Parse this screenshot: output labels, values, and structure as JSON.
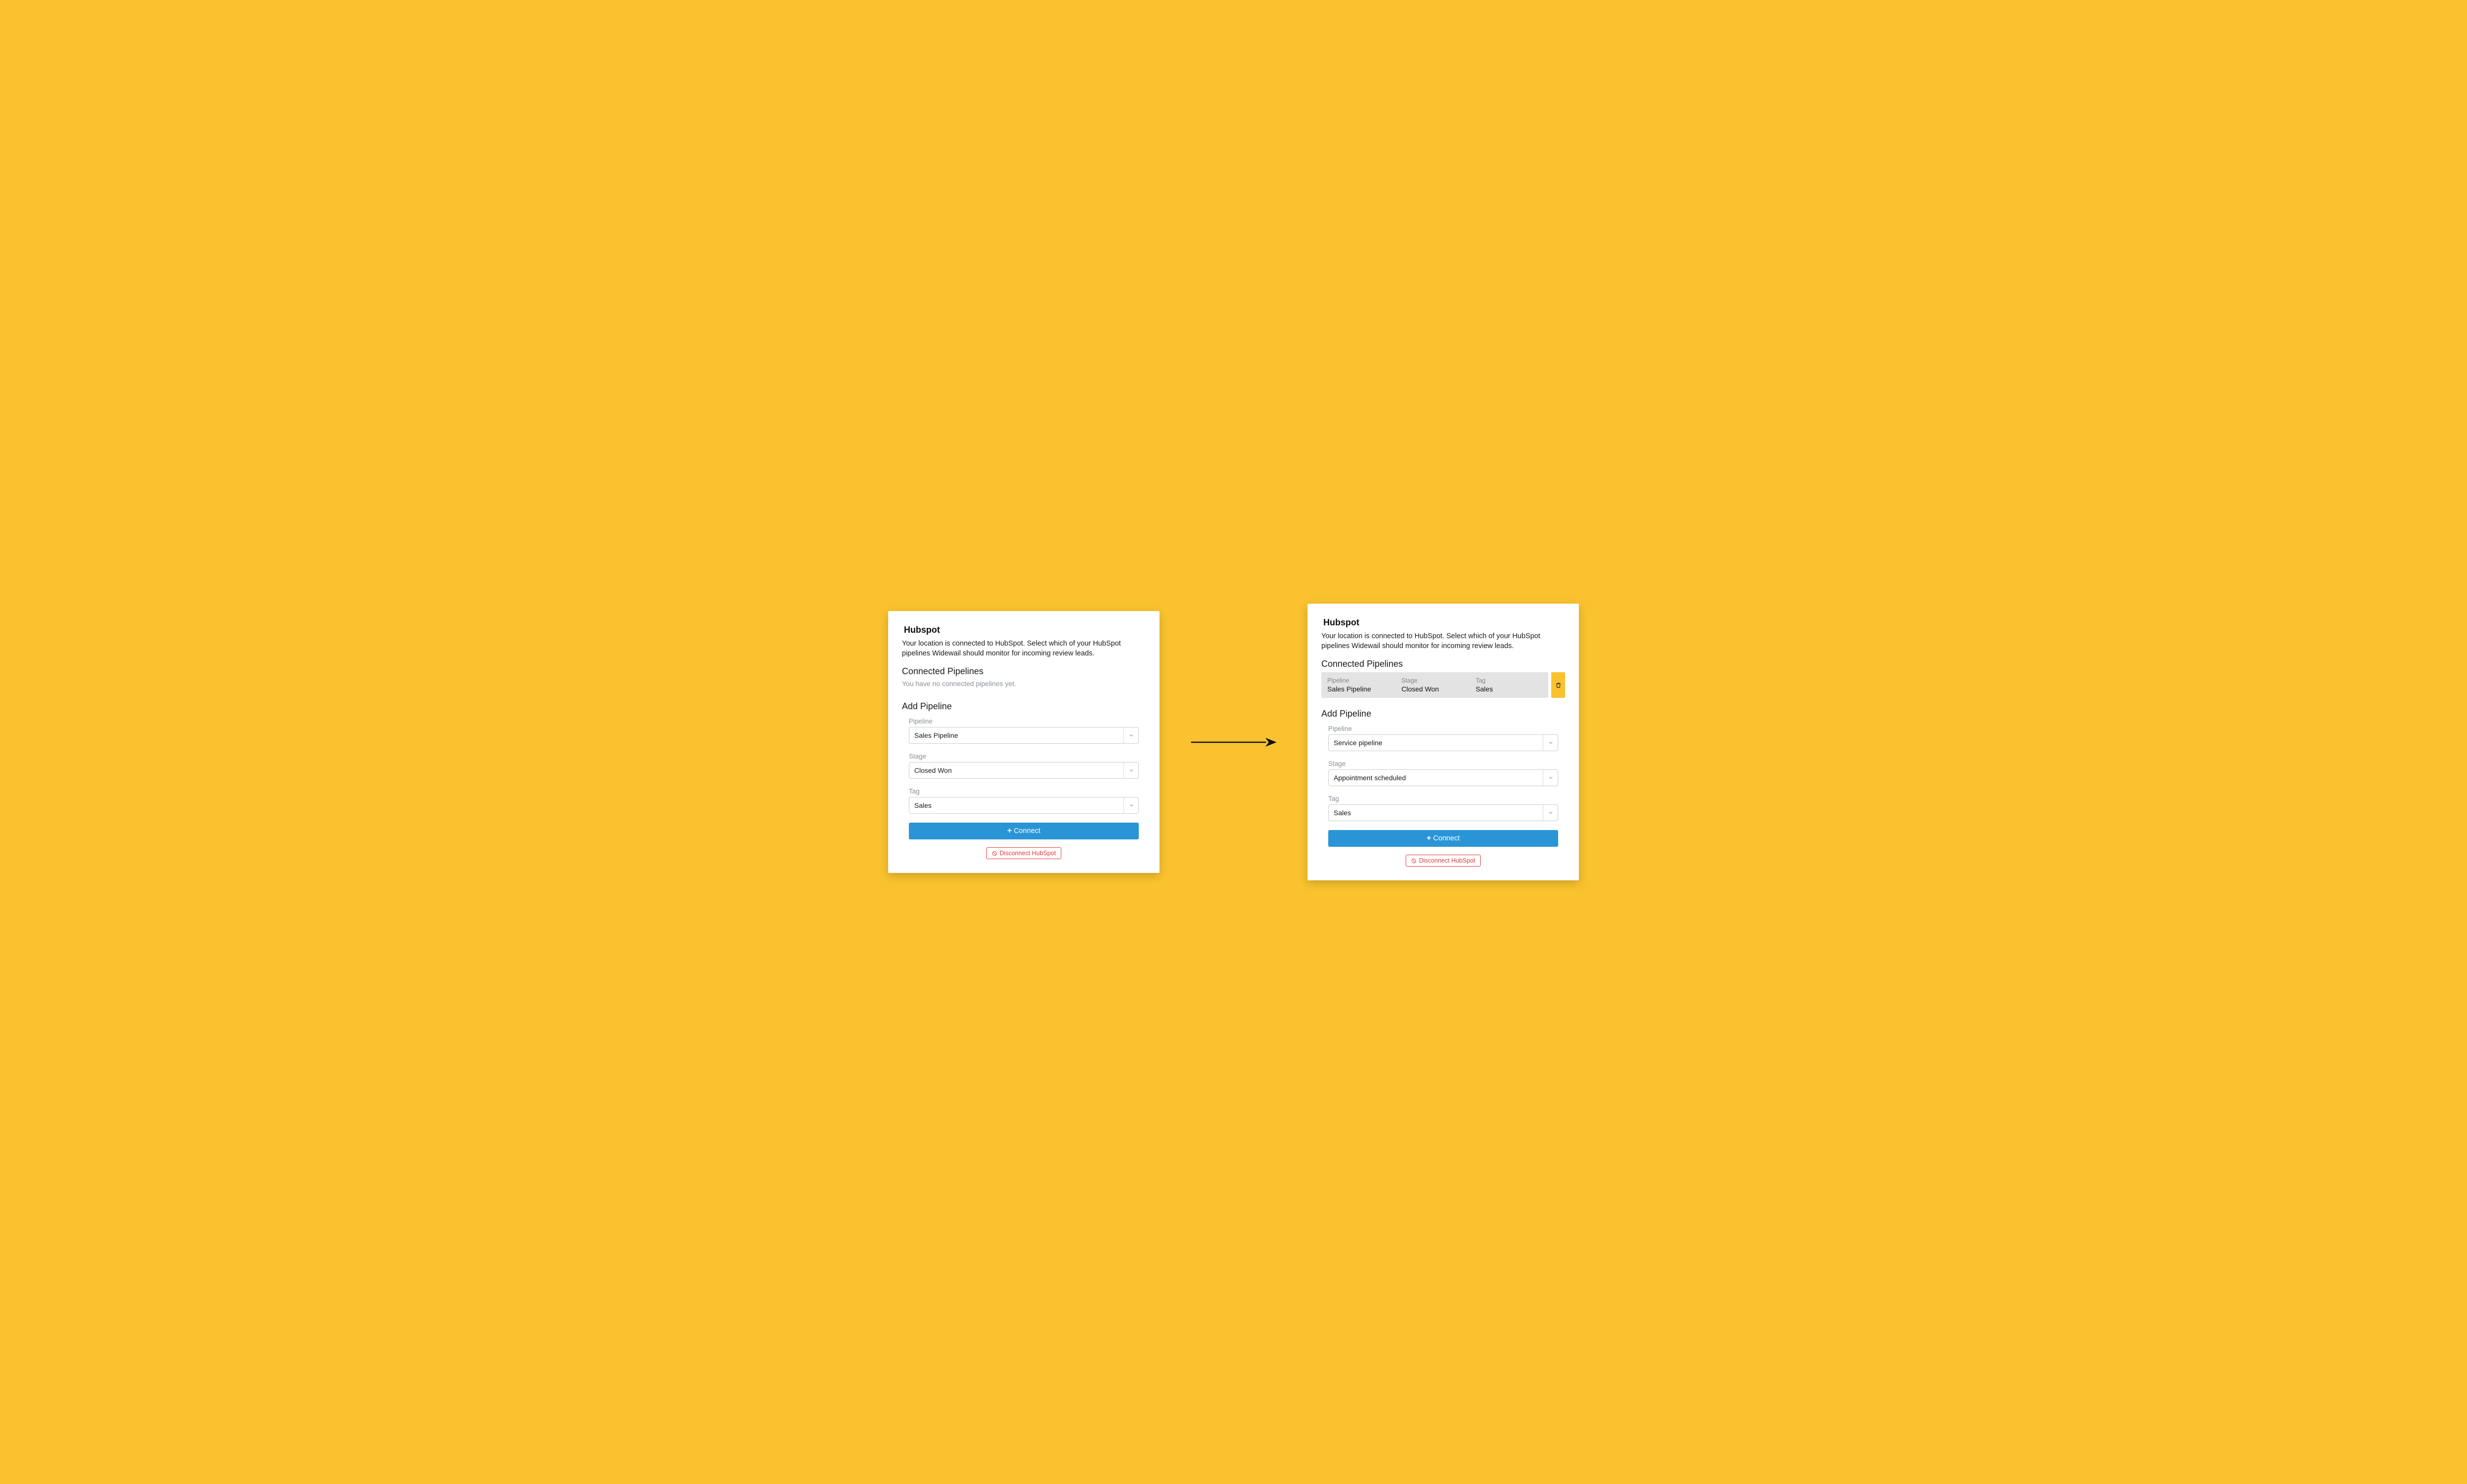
{
  "left": {
    "title": "Hubspot",
    "description": "Your location is connected to HubSpot. Select which of your HubSpot pipelines Widewail should monitor for incoming review leads.",
    "connected_heading": "Connected Pipelines",
    "empty_message": "You have no connected pipelines yet.",
    "add_heading": "Add Pipeline",
    "fields": {
      "pipeline": {
        "label": "Pipeline",
        "value": "Sales Pipeline"
      },
      "stage": {
        "label": "Stage",
        "value": "Closed Won"
      },
      "tag": {
        "label": "Tag",
        "value": "Sales"
      }
    },
    "connect_label": "Connect",
    "disconnect_label": "Disconnect HubSpot"
  },
  "right": {
    "title": "Hubspot",
    "description": "Your location is connected to HubSpot. Select which of your HubSpot pipelines Widewail should monitor for incoming review leads.",
    "connected_heading": "Connected Pipelines",
    "connected_pipeline": {
      "headers": {
        "pipeline": "Pipeline",
        "stage": "Stage",
        "tag": "Tag"
      },
      "values": {
        "pipeline": "Sales Pipeline",
        "stage": "Closed Won",
        "tag": "Sales"
      }
    },
    "add_heading": "Add Pipeline",
    "fields": {
      "pipeline": {
        "label": "Pipeline",
        "value": "Service pipeline"
      },
      "stage": {
        "label": "Stage",
        "value": "Appointment scheduled"
      },
      "tag": {
        "label": "Tag",
        "value": "Sales"
      }
    },
    "connect_label": "Connect",
    "disconnect_label": "Disconnect HubSpot"
  }
}
